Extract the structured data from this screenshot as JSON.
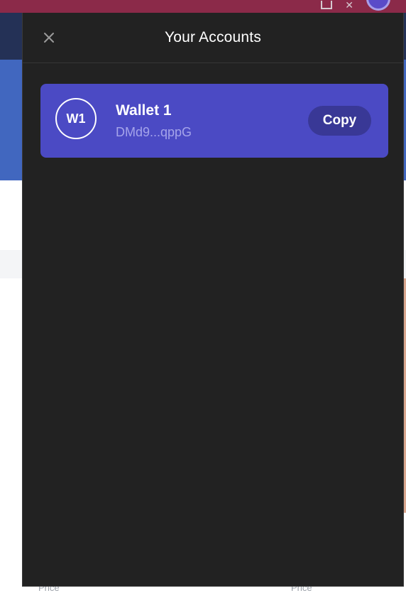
{
  "background": {
    "price_label_left": "Price",
    "price_label_right": "Price"
  },
  "panel": {
    "title": "Your Accounts",
    "close_icon": "close-icon"
  },
  "accounts": [
    {
      "avatar_initials": "W1",
      "name": "Wallet 1",
      "address": "DMd9...qppG",
      "copy_label": "Copy"
    }
  ],
  "colors": {
    "panel_bg": "#222222",
    "card_bg": "#4b4ac4",
    "copy_button_bg": "#393896",
    "address_text": "#a5a4ea"
  }
}
